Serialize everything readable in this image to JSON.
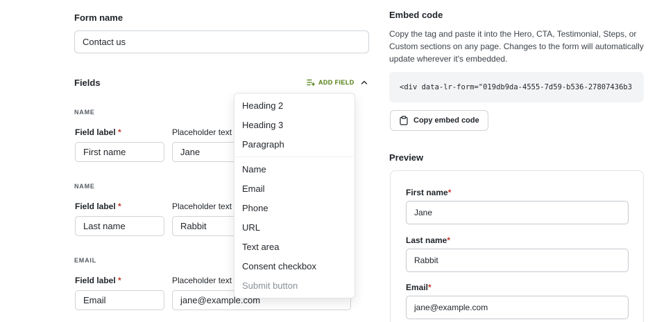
{
  "form_name": {
    "label": "Form name",
    "value": "Contact us"
  },
  "fields": {
    "title": "Fields",
    "add_field_label": "ADD FIELD",
    "groups": [
      {
        "type": "NAME",
        "field_label": "Field label",
        "field_value": "First name",
        "placeholder_label": "Placeholder text",
        "placeholder_value": "Jane"
      },
      {
        "type": "NAME",
        "field_label": "Field label",
        "field_value": "Last name",
        "placeholder_label": "Placeholder text",
        "placeholder_value": "Rabbit"
      },
      {
        "type": "EMAIL",
        "field_label": "Field label",
        "field_value": "Email",
        "placeholder_label": "Placeholder text",
        "placeholder_value": "jane@example.com"
      }
    ],
    "required_mark": "*"
  },
  "menu": {
    "items": [
      "Heading 2",
      "Heading 3",
      "Paragraph",
      "Name",
      "Email",
      "Phone",
      "URL",
      "Text area",
      "Consent checkbox",
      "Submit button"
    ]
  },
  "embed": {
    "title": "Embed code",
    "description": "Copy the tag and paste it into the Hero, CTA, Testimonial, Steps, or Custom sections on any page. Changes to the form will automatically update wherever it's embedded.",
    "code": "<div data-lr-form=\"019db9da-4555-7d59-b536-27807436b3",
    "copy_label": "Copy embed code"
  },
  "preview": {
    "title": "Preview",
    "fields": [
      {
        "label": "First name",
        "value": "Jane"
      },
      {
        "label": "Last name",
        "value": "Rabbit"
      },
      {
        "label": "Email",
        "value": "jane@example.com"
      }
    ]
  },
  "colors": {
    "accent": "#4d7c0f",
    "required": "#c0392b"
  }
}
